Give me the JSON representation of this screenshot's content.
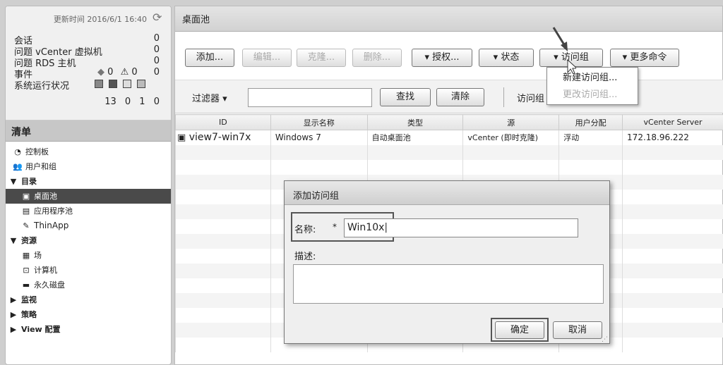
{
  "status": {
    "update_time": "更新时间 2016/6/1 16:40",
    "rows": [
      {
        "label": "会话",
        "value": "0"
      },
      {
        "label": "问题 vCenter 虚拟机",
        "value": "0"
      },
      {
        "label": "问题 RDS 主机",
        "value": "0"
      },
      {
        "label": "事件",
        "values": [
          "0",
          "0",
          "0"
        ]
      },
      {
        "label": "系统运行状况",
        "counts": [
          "13",
          "0",
          "1",
          "0"
        ]
      }
    ]
  },
  "nav": {
    "heading": "清单",
    "items": [
      {
        "label": "控制板",
        "icon": "dashboard-icon"
      },
      {
        "label": "用户和组",
        "icon": "users-icon"
      },
      {
        "label": "目录",
        "icon": "expand-icon"
      },
      {
        "label": "桌面池",
        "icon": "desktop-pool-icon"
      },
      {
        "label": "应用程序池",
        "icon": "app-pool-icon"
      },
      {
        "label": "ThinApp",
        "icon": "thinapp-icon"
      },
      {
        "label": "资源",
        "icon": "expand-icon"
      },
      {
        "label": "场",
        "icon": "farm-icon"
      },
      {
        "label": "计算机",
        "icon": "computer-icon"
      },
      {
        "label": "永久磁盘",
        "icon": "disk-icon"
      },
      {
        "label": "监视",
        "icon": "collapse-icon"
      },
      {
        "label": "策略",
        "icon": "collapse-icon"
      },
      {
        "label": "View 配置",
        "icon": "collapse-icon"
      }
    ]
  },
  "main": {
    "title": "桌面池",
    "toolbar": {
      "add": "添加...",
      "edit": "编辑...",
      "clone": "克隆...",
      "delete": "删除...",
      "entitle": "▾ 授权...",
      "status": "▾ 状态",
      "access_group": "▾ 访问组",
      "more": "▾ 更多命令"
    },
    "filter": {
      "label": "过滤器 ▾",
      "find": "查找",
      "clear": "清除",
      "access_group": "访问组"
    },
    "table": {
      "headers": [
        "ID",
        "显示名称",
        "类型",
        "源",
        "用户分配",
        "vCenter Server"
      ],
      "rows": [
        [
          "view7-win7x",
          "Windows 7",
          "自动桌面池",
          "vCenter (即时克隆)",
          "浮动",
          "172.18.96.222"
        ]
      ]
    },
    "dropdown": {
      "new": "新建访问组...",
      "change": "更改访问组..."
    }
  },
  "dialog": {
    "title": "添加访问组",
    "name_label": "名称:",
    "required": "*",
    "name_value": "Win10x",
    "desc_label": "描述:",
    "ok": "确定",
    "cancel": "取消"
  }
}
